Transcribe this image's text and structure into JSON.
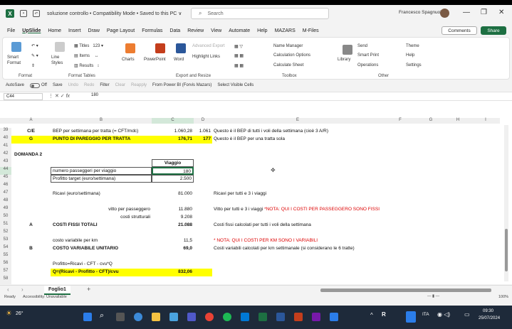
{
  "titlebar": {
    "doc_title": "soluzione controllo  •  Compatibility Mode  •  Saved to this PC  ∨",
    "search_placeholder": "Search",
    "user_name": "Francesco Spagnuolo",
    "minimize": "—",
    "restore": "❐",
    "close": "✕"
  },
  "menu": {
    "items": [
      "File",
      "UpSlide",
      "Home",
      "Insert",
      "Draw",
      "Page Layout",
      "Formulas",
      "Data",
      "Review",
      "View",
      "Automate",
      "Help",
      "MAZARS",
      "M-Files"
    ],
    "comments": "Comments",
    "share": "Share"
  },
  "ribbon": {
    "groups": [
      "Format",
      "Format Tables",
      "Export and Resize",
      "Toolbox",
      "Other"
    ],
    "smart_format": "Smart Format",
    "line_styles": "Line Styles",
    "titles": "Titles",
    "items": "Items",
    "results": "Results",
    "charts": "Charts",
    "powerpoint": "PowerPoint",
    "word": "Word",
    "advanced_export": "Advanced Export",
    "highlight_links": "Highlight Links",
    "name_manager": "Name Manager",
    "calc_options": "Calculation Options",
    "calc_sheet": "Calculate Sheet",
    "library": "Library",
    "send": "Send",
    "smart_print": "Smart Print",
    "operations": "Operations",
    "theme": "Theme",
    "help": "Help",
    "settings": "Settings"
  },
  "qat": {
    "autosave": "AutoSave",
    "autosave_state": "Off",
    "save": "Save",
    "undo": "Undo",
    "redo": "Redo",
    "filter": "Filter",
    "clear": "Clear",
    "reapply": "Reapply",
    "from_powerbi": "From Power BI (Forvis Mazars)",
    "select_visible": "Select Visible Cells"
  },
  "formula_bar": {
    "name_box": "C44",
    "value": "180"
  },
  "columns": [
    "A",
    "B",
    "C",
    "D",
    "E",
    "F",
    "G",
    "H",
    "I"
  ],
  "rows": [
    "39",
    "40",
    "41",
    "42",
    "43",
    "44",
    "45",
    "46",
    "47",
    "48",
    "49",
    "50",
    "51",
    "52",
    "53",
    "54",
    "55",
    "56",
    "57",
    "58"
  ],
  "cells": {
    "a39": "C/E",
    "b39": "BEP per settimana per tratta (= CFT/mdc)",
    "c39": "1.060,28",
    "d39": "1.061",
    "e39": "Questo è il BEP di tutti i voli della settimana (cioè 3 A/R)",
    "a40": "G",
    "b40": "PUNTO DI PAREGGIO PER TRATTA",
    "c40": "176,71",
    "d40": "177",
    "e40": "Questo è il BEP per una tratta sola",
    "a42": "DOMANDA 2",
    "c43": "Viaggio",
    "b44": "numero passeggeri per viaggio",
    "c44": "180",
    "b45": "Profitto target (euro/settimana)",
    "c45": "2.500",
    "b47": "Ricavi (euro/settimana)",
    "c47": "81.000",
    "e47": "Ricavi per tutti e 3 i viaggi",
    "b49": "vitto per passeggero",
    "c49": "11.880",
    "e49": "Vitto per tutti e 3 i viaggi",
    "e49_note": "*NOTA: QUI I COSTI PER PASSEGGERO SONO FISSI",
    "b50": "costi strutturali",
    "c50": "9.208",
    "a51": "A",
    "b51": "COSTI FISSI TOTALI",
    "c51": "21.088",
    "e51": "Costi fissi calcolati per tutti i voli della settimana",
    "b53": "costo variabile per km",
    "c53": "11,5",
    "e53": "* NOTA: QUI I COSTI PER KM SONO I VARIABILI",
    "a54": "B",
    "b54": "COSTO VARIABILE UNITARIO",
    "c54": "69,0",
    "e54": "Costi variabili calcolati per km settimanale (si considerano le 6 tratte)",
    "b56": "Profitto=Ricavi - CFT - cvu*Q",
    "b57": "Q=(Ricavi - Profitto - CFT)/cvu",
    "c57": "832,06"
  },
  "sheet": {
    "tab": "Foglio1",
    "add": "+"
  },
  "status": {
    "ready": "Ready",
    "accessibility": "Accessibility: Unavailable",
    "zoom": "100%"
  },
  "taskbar": {
    "weather": "26°",
    "lang": "ITA",
    "time": "09:30",
    "date": "25/07/2024"
  },
  "colors": {
    "excel_green": "#1d6f42",
    "highlight_yellow": "#ffff00",
    "note_red": "#d00000",
    "taskbar": "#1e2a3a"
  }
}
